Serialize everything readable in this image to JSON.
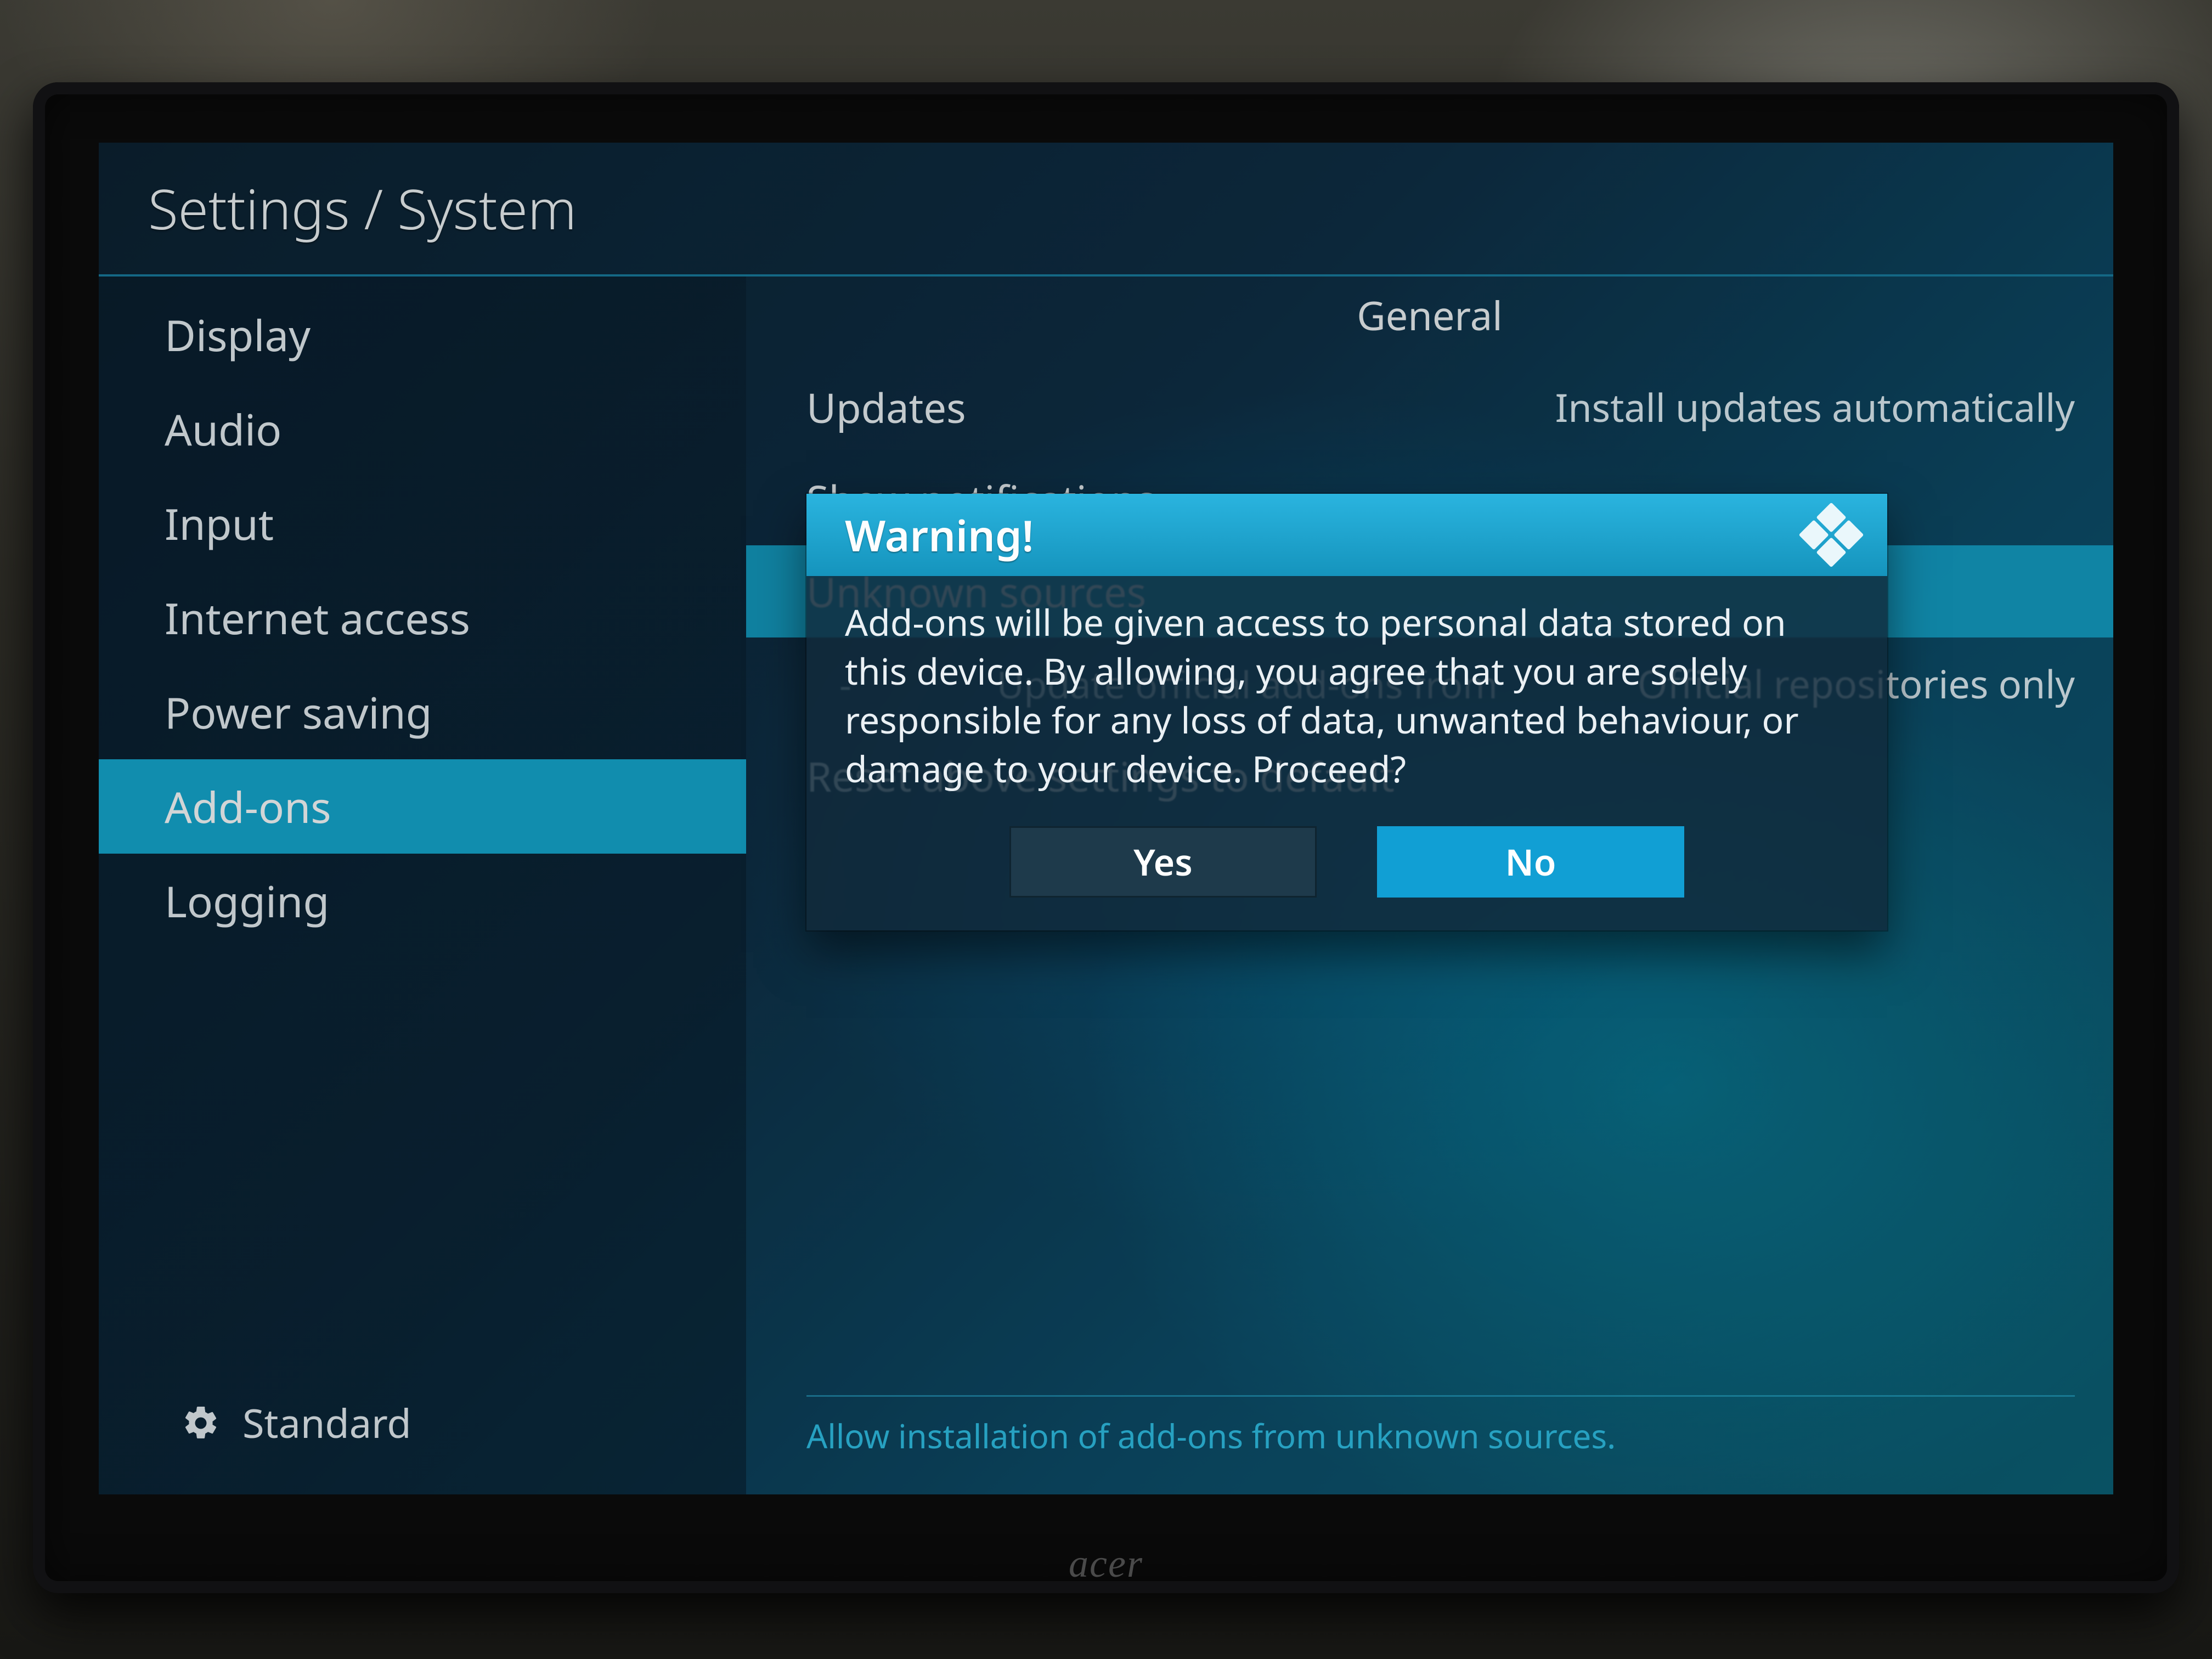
{
  "header": {
    "breadcrumb": "Settings / System"
  },
  "sidebar": {
    "items": [
      {
        "label": "Display"
      },
      {
        "label": "Audio"
      },
      {
        "label": "Input"
      },
      {
        "label": "Internet access"
      },
      {
        "label": "Power saving"
      },
      {
        "label": "Add-ons"
      },
      {
        "label": "Logging"
      }
    ],
    "selected_index": 5,
    "level_label": "Standard"
  },
  "panel": {
    "section": "General",
    "rows": [
      {
        "label": "Updates",
        "value": "Install updates automatically",
        "highlight": false,
        "sub": false
      },
      {
        "label": "Show notifications",
        "value": "",
        "highlight": false,
        "sub": false
      },
      {
        "label": "Unknown sources",
        "value": "",
        "highlight": true,
        "sub": false
      },
      {
        "label": "Update official add-ons from",
        "value": "Official repositories only",
        "highlight": false,
        "sub": true
      },
      {
        "label": "Reset above settings to default",
        "value": "",
        "highlight": false,
        "sub": false
      }
    ],
    "hint": "Allow installation of add-ons from unknown sources."
  },
  "dialog": {
    "title": "Warning!",
    "body": "Add-ons will be given access to personal data stored on this device. By allowing, you agree that you are solely responsible for any loss of data, unwanted behaviour, or damage to your device. Proceed?",
    "yes": "Yes",
    "no": "No"
  },
  "monitor_brand": "acer"
}
